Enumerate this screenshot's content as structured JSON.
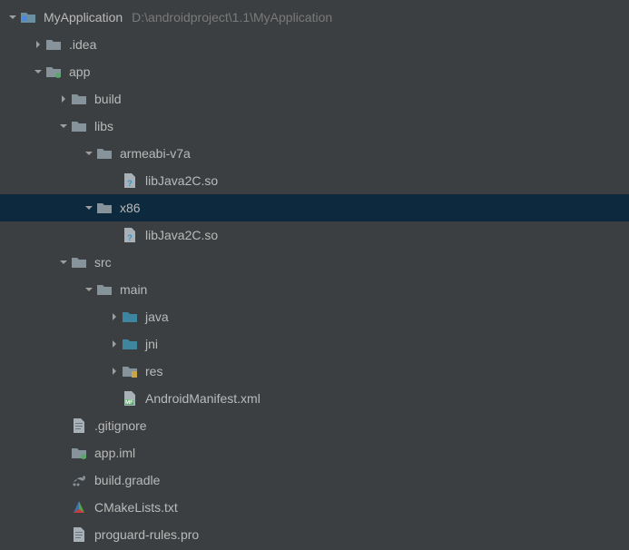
{
  "root": {
    "name": "MyApplication",
    "path": "D:\\androidproject\\1.1\\MyApplication"
  },
  "items": [
    {
      "depth": 0,
      "arrow": "down",
      "icon": "project-folder",
      "label_key": "root.name",
      "path_key": "root.path",
      "selected": false
    },
    {
      "depth": 1,
      "arrow": "right",
      "icon": "folder",
      "label": ".idea",
      "selected": false
    },
    {
      "depth": 1,
      "arrow": "down",
      "icon": "module-folder",
      "label": "app",
      "selected": false
    },
    {
      "depth": 2,
      "arrow": "right",
      "icon": "folder",
      "label": "build",
      "selected": false
    },
    {
      "depth": 2,
      "arrow": "down",
      "icon": "folder",
      "label": "libs",
      "selected": false
    },
    {
      "depth": 3,
      "arrow": "down",
      "icon": "folder",
      "label": "armeabi-v7a",
      "selected": false
    },
    {
      "depth": 4,
      "arrow": "none",
      "icon": "file-unknown",
      "label": "libJava2C.so",
      "selected": false
    },
    {
      "depth": 3,
      "arrow": "down",
      "icon": "folder",
      "label": "x86",
      "selected": true
    },
    {
      "depth": 4,
      "arrow": "none",
      "icon": "file-unknown",
      "label": "libJava2C.so",
      "selected": false
    },
    {
      "depth": 2,
      "arrow": "down",
      "icon": "folder",
      "label": "src",
      "selected": false
    },
    {
      "depth": 3,
      "arrow": "down",
      "icon": "folder",
      "label": "main",
      "selected": false
    },
    {
      "depth": 4,
      "arrow": "right",
      "icon": "source-folder",
      "label": "java",
      "selected": false
    },
    {
      "depth": 4,
      "arrow": "right",
      "icon": "source-folder",
      "label": "jni",
      "selected": false
    },
    {
      "depth": 4,
      "arrow": "right",
      "icon": "resource-folder",
      "label": "res",
      "selected": false
    },
    {
      "depth": 4,
      "arrow": "none",
      "icon": "manifest-file",
      "label": "AndroidManifest.xml",
      "selected": false
    },
    {
      "depth": 2,
      "arrow": "none",
      "icon": "text-file",
      "label": ".gitignore",
      "selected": false
    },
    {
      "depth": 2,
      "arrow": "none",
      "icon": "iml-file",
      "label": "app.iml",
      "selected": false
    },
    {
      "depth": 2,
      "arrow": "none",
      "icon": "gradle-file",
      "label": "build.gradle",
      "selected": false
    },
    {
      "depth": 2,
      "arrow": "none",
      "icon": "cmake-file",
      "label": "CMakeLists.txt",
      "selected": false
    },
    {
      "depth": 2,
      "arrow": "none",
      "icon": "text-file",
      "label": "proguard-rules.pro",
      "selected": false
    }
  ]
}
